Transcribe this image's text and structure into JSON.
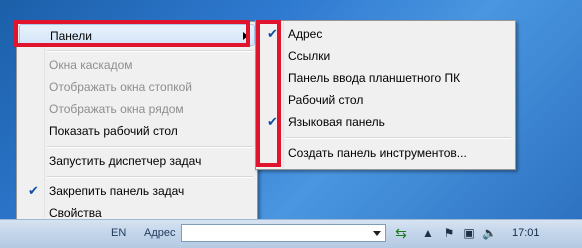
{
  "context_menu": {
    "items": [
      {
        "label": "Панели",
        "state": "highlighted",
        "submenu": true
      },
      {
        "label": "Окна каскадом",
        "state": "disabled"
      },
      {
        "label": "Отображать окна стопкой",
        "state": "disabled"
      },
      {
        "label": "Отображать окна рядом",
        "state": "disabled"
      },
      {
        "label": "Показать рабочий стол",
        "state": "enabled"
      },
      {
        "label": "Запустить диспетчер задач",
        "state": "enabled"
      },
      {
        "label": "Закрепить панель задач",
        "state": "checked"
      },
      {
        "label": "Свойства",
        "state": "enabled"
      }
    ]
  },
  "toolbars_submenu": {
    "items": [
      {
        "label": "Адрес",
        "checked": true
      },
      {
        "label": "Ссылки",
        "checked": false
      },
      {
        "label": "Панель ввода планшетного ПК",
        "checked": false
      },
      {
        "label": "Рабочий стол",
        "checked": false
      },
      {
        "label": "Языковая панель",
        "checked": true
      },
      {
        "label": "Создать панель инструментов...",
        "checked": false
      }
    ]
  },
  "taskbar": {
    "language": "EN",
    "address_label": "Адрес",
    "address_value": "",
    "clock": "17:01",
    "tray_icons": [
      "up-arrow-icon",
      "action-center-flag-icon",
      "network-icon",
      "volume-icon"
    ]
  },
  "colors": {
    "highlight_box": "#e0142d",
    "check_mark": "#0f4fa3",
    "desktop": "#2f7ad1"
  }
}
